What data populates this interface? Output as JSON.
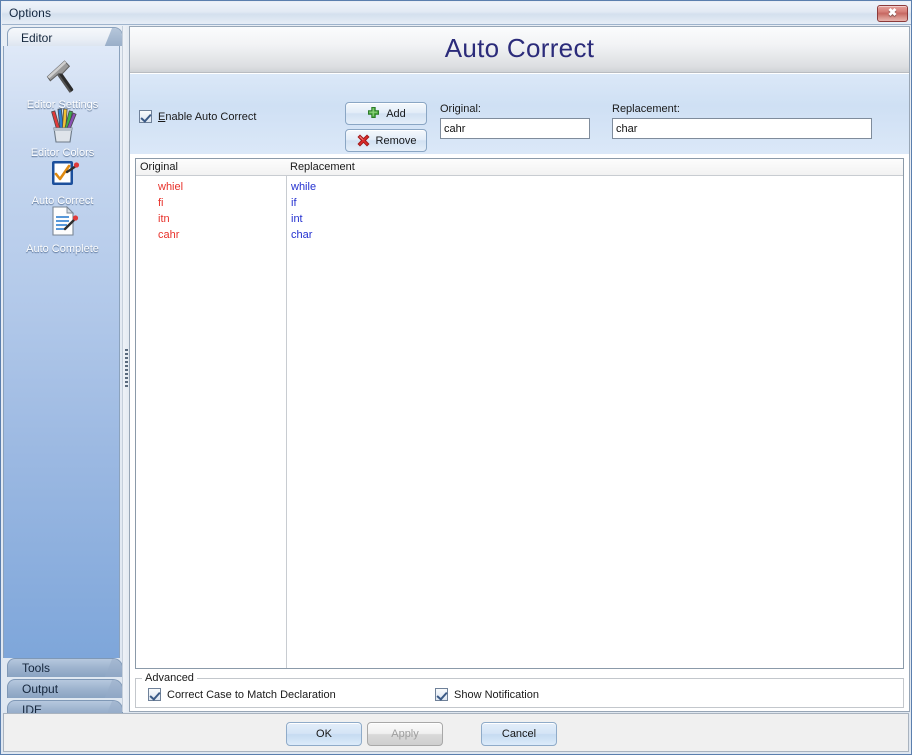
{
  "window": {
    "title": "Options",
    "close_icon": "close-icon",
    "close_glyph": "✖"
  },
  "sidebar": {
    "active_tab": "Editor",
    "items": [
      {
        "label": "Editor Settings",
        "icon": "hammer-icon",
        "selected": false
      },
      {
        "label": "Editor Colors",
        "icon": "pencil-cup-icon",
        "selected": false
      },
      {
        "label": "Auto Correct",
        "icon": "checked-page-icon",
        "selected": true
      },
      {
        "label": "Auto Complete",
        "icon": "document-pencil-icon",
        "selected": false
      }
    ],
    "bottom_tabs": [
      {
        "label": "Tools"
      },
      {
        "label": "Output"
      },
      {
        "label": "IDE"
      }
    ]
  },
  "main": {
    "page_title": "Auto Correct",
    "enable_checkbox": {
      "label_accel": "E",
      "label_rest": "nable Auto Correct",
      "checked": true
    },
    "buttons": {
      "add": "Add",
      "remove": "Remove"
    },
    "fields": {
      "original": {
        "label": "Original:",
        "value": "cahr",
        "placeholder": ""
      },
      "replacement": {
        "label": "Replacement:",
        "value": "char",
        "placeholder": ""
      }
    },
    "list": {
      "columns": [
        "Original",
        "Replacement"
      ],
      "rows": [
        {
          "original": "whiel",
          "replacement": "while"
        },
        {
          "original": "fi",
          "replacement": "if"
        },
        {
          "original": "itn",
          "replacement": "int"
        },
        {
          "original": "cahr",
          "replacement": "char"
        }
      ]
    },
    "advanced": {
      "legend": "Advanced",
      "options": [
        {
          "label": "Correct Case to Match Declaration",
          "checked": true
        },
        {
          "label": "Show Notification",
          "checked": true
        }
      ]
    }
  },
  "footer": {
    "ok": "OK",
    "apply": "Apply",
    "cancel": "Cancel",
    "apply_enabled": false
  },
  "colors": {
    "title_text": "#2b2b7a",
    "list_original": "#e8312a",
    "list_replacement": "#2330d0",
    "sidebar_top": "#dfe9f8",
    "sidebar_bottom": "#7ea6da",
    "close_button": "#c66862"
  }
}
